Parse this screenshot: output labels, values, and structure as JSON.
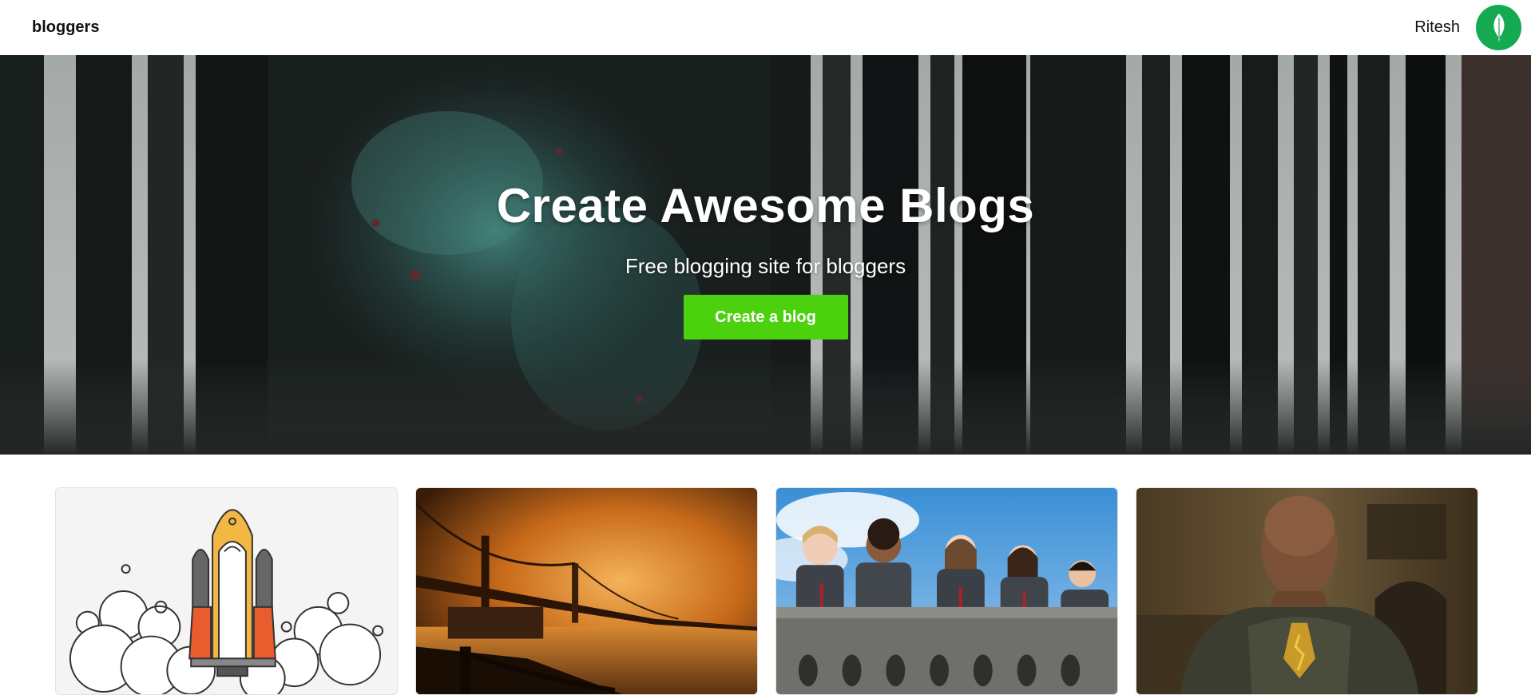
{
  "navbar": {
    "brand": "bloggers",
    "username": "Ritesh",
    "avatar_icon": "leaf-icon",
    "avatar_color": "#13aa52"
  },
  "hero": {
    "title": "Create Awesome Blogs",
    "subtitle": "Free blogging site for bloggers",
    "cta_label": "Create a blog",
    "cta_color": "#4cd10f"
  },
  "blogs": [
    {
      "image": "rocket-launch-illustration"
    },
    {
      "image": "foggy-bridge-at-night-photo"
    },
    {
      "image": "children-on-balcony-photo"
    },
    {
      "image": "man-in-armored-suit-photo"
    }
  ]
}
